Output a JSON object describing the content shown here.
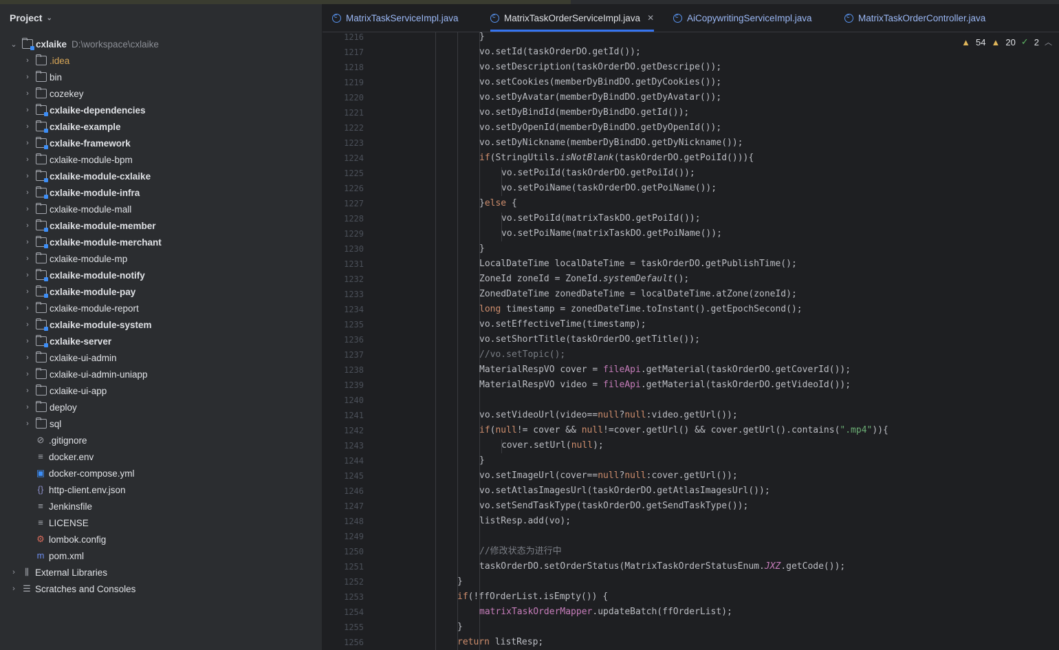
{
  "project_panel": {
    "title": "Project",
    "root": {
      "name": "cxlaike",
      "path": "D:\\workspace\\cxlaike"
    },
    "items": [
      {
        "label": ".idea",
        "kind": "folder",
        "style": "idea",
        "expandable": true
      },
      {
        "label": "bin",
        "kind": "folder",
        "expandable": true
      },
      {
        "label": "cozekey",
        "kind": "folder",
        "expandable": true
      },
      {
        "label": "cxlaike-dependencies",
        "kind": "module",
        "style": "bold",
        "expandable": true
      },
      {
        "label": "cxlaike-example",
        "kind": "module",
        "style": "bold",
        "expandable": true
      },
      {
        "label": "cxlaike-framework",
        "kind": "module",
        "style": "bold",
        "expandable": true
      },
      {
        "label": "cxlaike-module-bpm",
        "kind": "folder",
        "expandable": true
      },
      {
        "label": "cxlaike-module-cxlaike",
        "kind": "module",
        "style": "bold",
        "expandable": true
      },
      {
        "label": "cxlaike-module-infra",
        "kind": "module",
        "style": "bold",
        "expandable": true
      },
      {
        "label": "cxlaike-module-mall",
        "kind": "folder",
        "expandable": true
      },
      {
        "label": "cxlaike-module-member",
        "kind": "module",
        "style": "bold",
        "expandable": true
      },
      {
        "label": "cxlaike-module-merchant",
        "kind": "module",
        "style": "bold",
        "expandable": true
      },
      {
        "label": "cxlaike-module-mp",
        "kind": "folder",
        "expandable": true
      },
      {
        "label": "cxlaike-module-notify",
        "kind": "module",
        "style": "bold",
        "expandable": true
      },
      {
        "label": "cxlaike-module-pay",
        "kind": "module",
        "style": "bold",
        "expandable": true
      },
      {
        "label": "cxlaike-module-report",
        "kind": "folder",
        "expandable": true
      },
      {
        "label": "cxlaike-module-system",
        "kind": "module",
        "style": "bold",
        "expandable": true
      },
      {
        "label": "cxlaike-server",
        "kind": "module",
        "style": "bold",
        "expandable": true
      },
      {
        "label": "cxlaike-ui-admin",
        "kind": "folder",
        "expandable": true
      },
      {
        "label": "cxlaike-ui-admin-uniapp",
        "kind": "folder",
        "expandable": true
      },
      {
        "label": "cxlaike-ui-app",
        "kind": "folder",
        "expandable": true
      },
      {
        "label": "deploy",
        "kind": "folder",
        "expandable": true
      },
      {
        "label": "sql",
        "kind": "folder",
        "expandable": true
      },
      {
        "label": ".gitignore",
        "kind": "file",
        "icon": "ignore-icon",
        "glyph": "⊘",
        "expandable": false
      },
      {
        "label": "docker.env",
        "kind": "file",
        "icon": "text-file-icon",
        "glyph": "≡",
        "expandable": false
      },
      {
        "label": "docker-compose.yml",
        "kind": "file",
        "icon": "docker-icon",
        "glyph": "▣",
        "expandable": false
      },
      {
        "label": "http-client.env.json",
        "kind": "file",
        "icon": "json-icon",
        "glyph": "{}",
        "expandable": false
      },
      {
        "label": "Jenkinsfile",
        "kind": "file",
        "icon": "text-file-icon",
        "glyph": "≡",
        "expandable": false
      },
      {
        "label": "LICENSE",
        "kind": "file",
        "icon": "text-file-icon",
        "glyph": "≡",
        "expandable": false
      },
      {
        "label": "lombok.config",
        "kind": "file",
        "icon": "config-icon",
        "glyph": "⚙",
        "expandable": false
      },
      {
        "label": "pom.xml",
        "kind": "file",
        "icon": "maven-icon",
        "glyph": "m",
        "expandable": false
      }
    ],
    "external_libraries": "External Libraries",
    "scratches": "Scratches and Consoles"
  },
  "tabs": [
    {
      "label": "MatrixTaskServiceImpl.java",
      "active": false
    },
    {
      "label": "MatrixTaskOrderServiceImpl.java",
      "active": true
    },
    {
      "label": "AiCopywritingServiceImpl.java",
      "active": false
    },
    {
      "label": "MatrixTaskOrderController.java",
      "active": false
    }
  ],
  "inspections": {
    "warnings": "54",
    "weak_warnings": "20",
    "typos": "2"
  },
  "editor": {
    "first_line": 1216,
    "lines": [
      {
        "n": "1216",
        "t": "}",
        "ind": 5
      },
      {
        "n": "1217",
        "t": "vo.setId(taskOrderDO.getId());",
        "ind": 5
      },
      {
        "n": "1218",
        "t": "vo.setDescription(taskOrderDO.getDescripe());",
        "ind": 5
      },
      {
        "n": "1219",
        "t": "vo.setCookies(memberDyBindDO.getDyCookies());",
        "ind": 5
      },
      {
        "n": "1220",
        "t": "vo.setDyAvatar(memberDyBindDO.getDyAvatar());",
        "ind": 5
      },
      {
        "n": "1221",
        "t": "vo.setDyBindId(memberDyBindDO.getId());",
        "ind": 5
      },
      {
        "n": "1222",
        "t": "vo.setDyOpenId(memberDyBindDO.getDyOpenId());",
        "ind": 5
      },
      {
        "n": "1223",
        "t": "vo.setDyNickname(memberDyBindDO.getDyNickname());",
        "ind": 5
      },
      {
        "n": "1224",
        "t": "if(StringUtils.isNotBlank(taskOrderDO.getPoiId())){",
        "ind": 5
      },
      {
        "n": "1225",
        "t": "vo.setPoiId(taskOrderDO.getPoiId());",
        "ind": 6
      },
      {
        "n": "1226",
        "t": "vo.setPoiName(taskOrderDO.getPoiName());",
        "ind": 6
      },
      {
        "n": "1227",
        "t": "}else {",
        "ind": 5
      },
      {
        "n": "1228",
        "t": "vo.setPoiId(matrixTaskDO.getPoiId());",
        "ind": 6
      },
      {
        "n": "1229",
        "t": "vo.setPoiName(matrixTaskDO.getPoiName());",
        "ind": 6
      },
      {
        "n": "1230",
        "t": "}",
        "ind": 5
      },
      {
        "n": "1231",
        "t": "LocalDateTime localDateTime = taskOrderDO.getPublishTime();",
        "ind": 5
      },
      {
        "n": "1232",
        "t": "ZoneId zoneId = ZoneId.systemDefault();",
        "ind": 5
      },
      {
        "n": "1233",
        "t": "ZonedDateTime zonedDateTime = localDateTime.atZone(zoneId);",
        "ind": 5
      },
      {
        "n": "1234",
        "t": "long timestamp = zonedDateTime.toInstant().getEpochSecond();",
        "ind": 5
      },
      {
        "n": "1235",
        "t": "vo.setEffectiveTime(timestamp);",
        "ind": 5
      },
      {
        "n": "1236",
        "t": "vo.setShortTitle(taskOrderDO.getTitle());",
        "ind": 5
      },
      {
        "n": "1237",
        "t": "//vo.setTopic();",
        "ind": 5
      },
      {
        "n": "1238",
        "t": "MaterialRespVO cover = fileApi.getMaterial(taskOrderDO.getCoverId());",
        "ind": 5
      },
      {
        "n": "1239",
        "t": "MaterialRespVO video = fileApi.getMaterial(taskOrderDO.getVideoId());",
        "ind": 5
      },
      {
        "n": "1240",
        "t": "",
        "ind": 5
      },
      {
        "n": "1241",
        "t": "vo.setVideoUrl(video==null?null:video.getUrl());",
        "ind": 5
      },
      {
        "n": "1242",
        "t": "if(null!= cover && null!=cover.getUrl() && cover.getUrl().contains(\".mp4\")){",
        "ind": 5
      },
      {
        "n": "1243",
        "t": "cover.setUrl(null);",
        "ind": 6
      },
      {
        "n": "1244",
        "t": "}",
        "ind": 5
      },
      {
        "n": "1245",
        "t": "vo.setImageUrl(cover==null?null:cover.getUrl());",
        "ind": 5
      },
      {
        "n": "1246",
        "t": "vo.setAtlasImagesUrl(taskOrderDO.getAtlasImagesUrl());",
        "ind": 5
      },
      {
        "n": "1247",
        "t": "vo.setSendTaskType(taskOrderDO.getSendTaskType());",
        "ind": 5
      },
      {
        "n": "1248",
        "t": "listResp.add(vo);",
        "ind": 5
      },
      {
        "n": "1249",
        "t": "",
        "ind": 5
      },
      {
        "n": "1250",
        "t": "//修改状态为进行中",
        "ind": 5
      },
      {
        "n": "1251",
        "t": "taskOrderDO.setOrderStatus(MatrixTaskOrderStatusEnum.JXZ.getCode());",
        "ind": 5
      },
      {
        "n": "1252",
        "t": "}",
        "ind": 4
      },
      {
        "n": "1253",
        "t": "if(!ffOrderList.isEmpty()) {",
        "ind": 4
      },
      {
        "n": "1254",
        "t": "matrixTaskOrderMapper.updateBatch(ffOrderList);",
        "ind": 5
      },
      {
        "n": "1255",
        "t": "}",
        "ind": 4
      },
      {
        "n": "1256",
        "t": "return listResp;",
        "ind": 4
      }
    ]
  }
}
